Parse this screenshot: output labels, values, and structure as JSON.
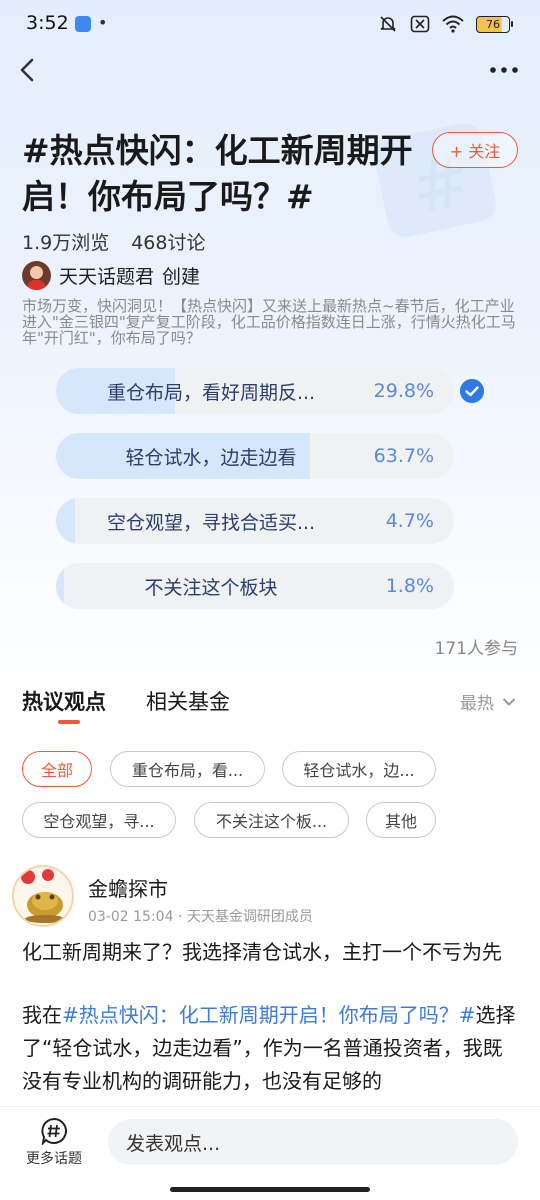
{
  "status_bar": {
    "time": "3:52",
    "dot": "•",
    "battery": "76"
  },
  "title": "#热点快闪：化工新周期开启！你布局了吗？#",
  "follow_label": "+ 关注",
  "stats": {
    "views": "1.9万浏览",
    "discussions": "468讨论"
  },
  "creator": {
    "name": "天天话题君",
    "role": "创建"
  },
  "description": "市场万变，快闪洞见！【热点快闪】又来送上最新热点~春节后，化工产业进入\"金三银四\"复产复工阶段，化工品价格指数连日上涨，行情火热化工马年\"开门红\"，你布局了吗？",
  "poll": {
    "options": [
      {
        "label": "重仓布局，看好周期反...",
        "percent": "29.8%",
        "ratio": 0.298,
        "selected": true
      },
      {
        "label": "轻仓试水，边走边看",
        "percent": "63.7%",
        "ratio": 0.637,
        "selected": false
      },
      {
        "label": "空仓观望，寻找合适买...",
        "percent": "4.7%",
        "ratio": 0.047,
        "selected": false
      },
      {
        "label": "不关注这个板块",
        "percent": "1.8%",
        "ratio": 0.018,
        "selected": false
      }
    ],
    "participants": "171人参与"
  },
  "tabs": [
    {
      "label": "热议观点",
      "active": true
    },
    {
      "label": "相关基金",
      "active": false
    }
  ],
  "sort_label": "最热",
  "filter_chips": [
    "全部",
    "重仓布局，看...",
    "轻仓试水，边...",
    "空仓观望，寻...",
    "不关注这个板...",
    "其他"
  ],
  "post": {
    "author": "金蟾探市",
    "time": "03-02 15:04",
    "badge": "天天基金调研团成员",
    "headline": "化工新周期来了？我选择清仓试水，主打一个不亏为先",
    "body_prefix": "我在",
    "body_hashtag": "#热点快闪：化工新周期开启！你布局了吗？#",
    "body_rest": "选择了“轻仓试水，边走边看”，作为一名普通投资者，我既没有专业机构的调研能力，也没有足够的"
  },
  "bottom_bar": {
    "more_topics": "更多话题",
    "input_placeholder": "发表观点..."
  },
  "colors": {
    "accent": "#f05a3c",
    "link": "#3d7bd9",
    "poll_fill": "#d6e7fb",
    "check": "#2f7ae5"
  }
}
